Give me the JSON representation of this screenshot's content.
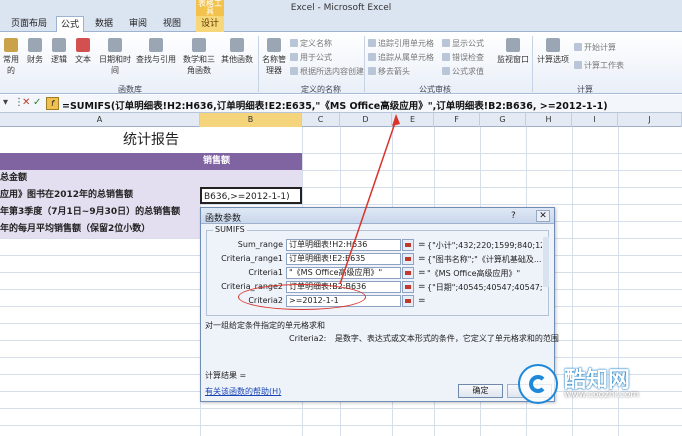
{
  "window": {
    "title": "Excel - Microsoft Excel",
    "contextual_tab": "表格工具"
  },
  "tabs": [
    {
      "label": "页面布局"
    },
    {
      "label": "公式"
    },
    {
      "label": "数据"
    },
    {
      "label": "审阅"
    },
    {
      "label": "视图"
    },
    {
      "label": "设计"
    }
  ],
  "ribbon": {
    "buttons": [
      "常用的",
      "财务",
      "逻辑",
      "文本",
      "日期和时间",
      "查找与引用",
      "数学和三角函数",
      "其他函数",
      "名称管理器"
    ],
    "name_items": [
      "定义名称",
      "用于公式",
      "根据所选内容创建"
    ],
    "audit_items": [
      "追踪引用单元格",
      "追踪从属单元格",
      "移去箭头",
      "显示公式",
      "错误检查",
      "公式求值"
    ],
    "watch": "监视窗口",
    "calc_options": "计算选项",
    "calc_items": [
      "开始计算",
      "计算工作表"
    ],
    "groups": [
      "函数库",
      "定义的名称",
      "公式审核",
      "计算"
    ]
  },
  "formula_bar": {
    "formula": "=SUMIFS(订单明细表!H2:H636,订单明细表!E2:E635,\"《MS Office高级应用》\",订单明细表!B2:B636, >=2012-1-1)"
  },
  "columns": [
    "A",
    "B",
    "C",
    "D",
    "E",
    "F",
    "G",
    "H",
    "I",
    "J"
  ],
  "sheet": {
    "report_title": "统计报告",
    "header_b": "销售额",
    "row_total": "总金额",
    "row1": "应用》图书在2012年的总销售额",
    "row1_value": "B636,>=2012-1-1)",
    "row2": "年第3季度（7月1日~9月30日）的总销售额",
    "row3": "年的每月平均销售额（保留2位小数）"
  },
  "dialog": {
    "title": "函数参数",
    "help": "?",
    "close": "✕",
    "func": "SUMIFS",
    "args": [
      {
        "label": "Sum_range",
        "value": "订单明细表!H2:H636",
        "result": "{\"小计\";432;220;1599;840;12..."
      },
      {
        "label": "Criteria_range1",
        "value": "订单明细表!E2:E635",
        "result": "{\"图书名称\";\"《计算机基础及..."
      },
      {
        "label": "Criteria1",
        "value": "\"《MS Office高级应用》\"",
        "result": "\"《MS Office高级应用》\""
      },
      {
        "label": "Criteria_range2",
        "value": "订单明细表!B2:B636",
        "result": "{\"日期\";40545;40547;40547;4054"
      },
      {
        "label": "Criteria2",
        "value": ">=2012-1-1",
        "result": ""
      }
    ],
    "desc_main": "对一组给定条件指定的单元格求和",
    "desc_arg_name": "Criteria2:",
    "desc_arg_text": "是数字、表达式或文本形式的条件，它定义了单元格求和的范围",
    "calc_result_label": "计算结果 =",
    "help_link": "有关该函数的帮助(H)",
    "ok": "确定"
  },
  "watermark": {
    "name": "酷知网",
    "url": "www.coozhi.com"
  }
}
